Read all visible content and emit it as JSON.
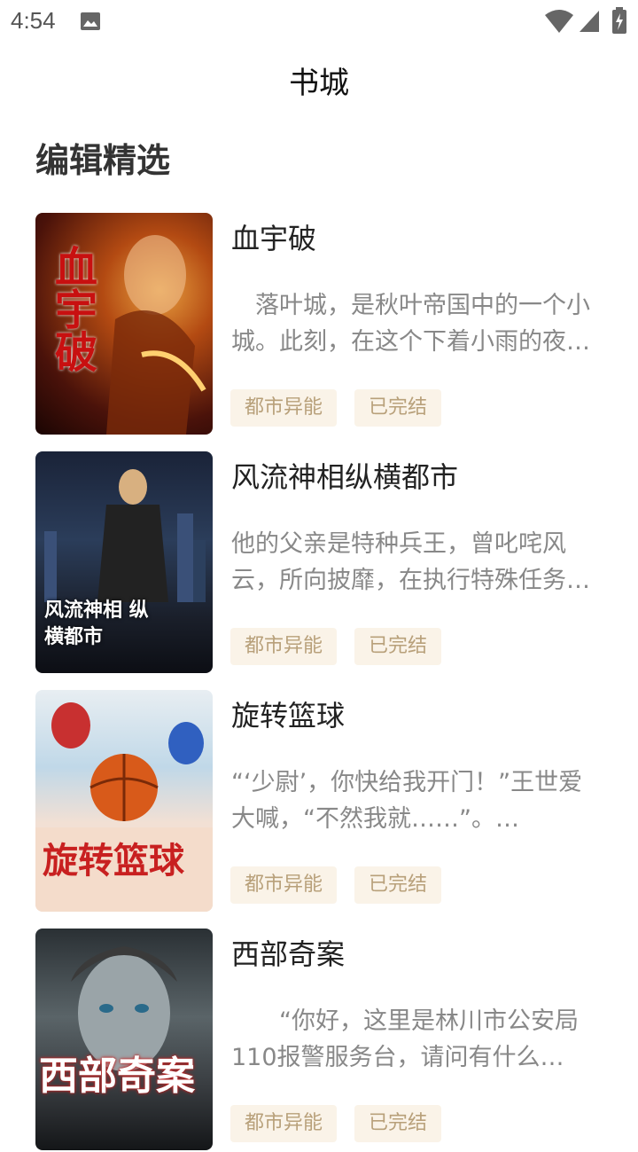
{
  "status_bar": {
    "time": "4:54"
  },
  "header": {
    "title": "书城"
  },
  "section": {
    "title": "编辑精选"
  },
  "books": [
    {
      "name": "血宇破",
      "desc": "　落叶城，是秋叶帝国中的一个小城。此刻，在这个下着小雨的夜…",
      "tags": [
        "都市异能",
        "已完结"
      ],
      "cover_text": "血宇破"
    },
    {
      "name": "风流神相纵横都市",
      "desc": "他的父亲是特种兵王，曾叱咤风云，所向披靡，在执行特殊任务…",
      "tags": [
        "都市异能",
        "已完结"
      ],
      "cover_text": "风流神相 纵横都市"
    },
    {
      "name": "旋转篮球",
      "desc": "“‘少尉’，你快给我开门！”王世爱大喊，“不然我就……”。…",
      "tags": [
        "都市异能",
        "已完结"
      ],
      "cover_text": "旋转篮球"
    },
    {
      "name": "西部奇案",
      "desc": "　　“你好，这里是林川市公安局110报警服务台，请问有什么…",
      "tags": [
        "都市异能",
        "已完结"
      ],
      "cover_text": "西部奇案"
    }
  ]
}
